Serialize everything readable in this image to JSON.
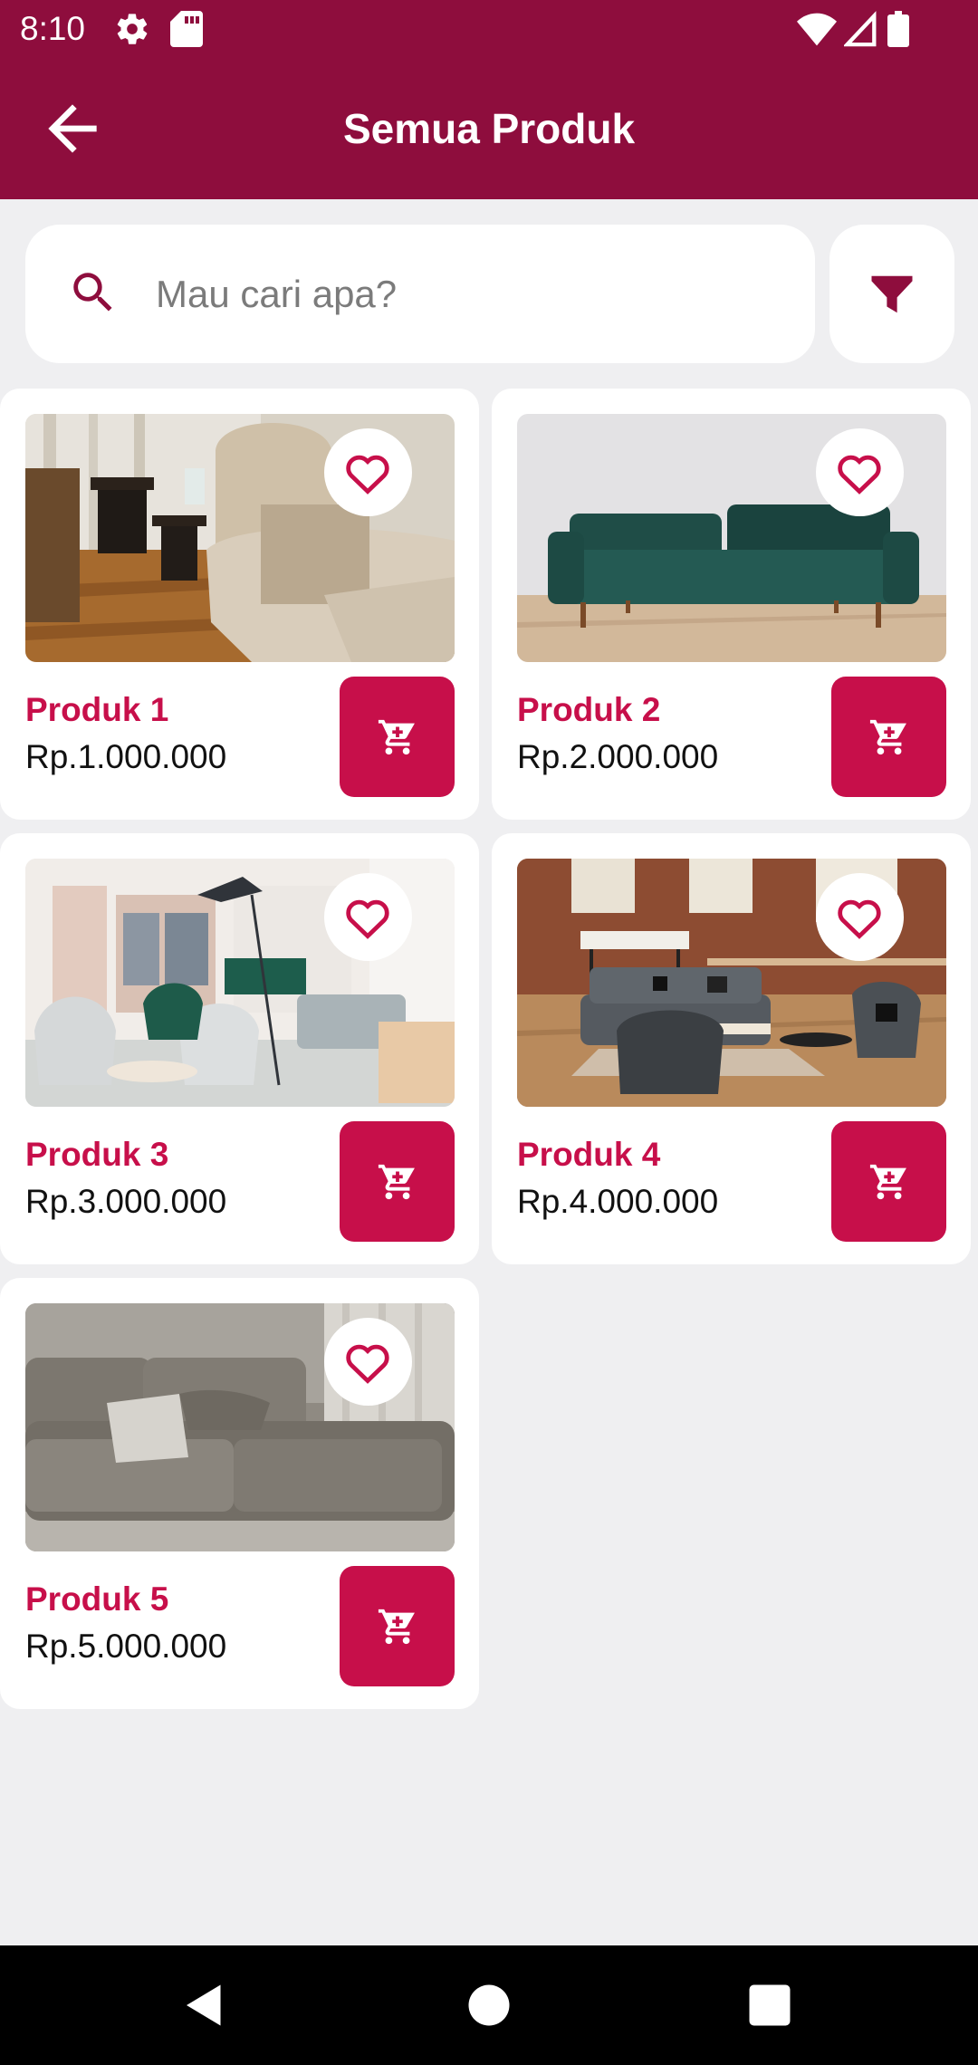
{
  "status_bar": {
    "time": "8:10",
    "left_icons": [
      "settings-icon",
      "sd-card-icon"
    ],
    "right_icons": [
      "wifi-icon",
      "signal-icon",
      "battery-icon"
    ]
  },
  "app_bar": {
    "title": "Semua Produk",
    "back_icon": "arrow-back-icon"
  },
  "search": {
    "placeholder": "Mau cari apa?",
    "value": "",
    "icon": "search-icon"
  },
  "filter": {
    "icon": "filter-icon"
  },
  "products": [
    {
      "name": "Produk 1",
      "price": "Rp.1.000.000",
      "image": "living-room-armchair-photo"
    },
    {
      "name": "Produk 2",
      "price": "Rp.2.000.000",
      "image": "green-velvet-sofa-photo"
    },
    {
      "name": "Produk 3",
      "price": "Rp.3.000.000",
      "image": "office-lounge-chairs-photo"
    },
    {
      "name": "Produk 4",
      "price": "Rp.4.000.000",
      "image": "loft-grey-sofa-photo"
    },
    {
      "name": "Produk 5",
      "price": "Rp.5.000.000",
      "image": "grey-sectional-sofa-photo"
    }
  ],
  "nav_bar": {
    "icons": [
      "back-triangle-icon",
      "home-circle-icon",
      "recents-square-icon"
    ]
  },
  "colors": {
    "primary": "#8e0d3d",
    "accent": "#c70f4a",
    "background": "#efeff1",
    "card": "#ffffff"
  }
}
